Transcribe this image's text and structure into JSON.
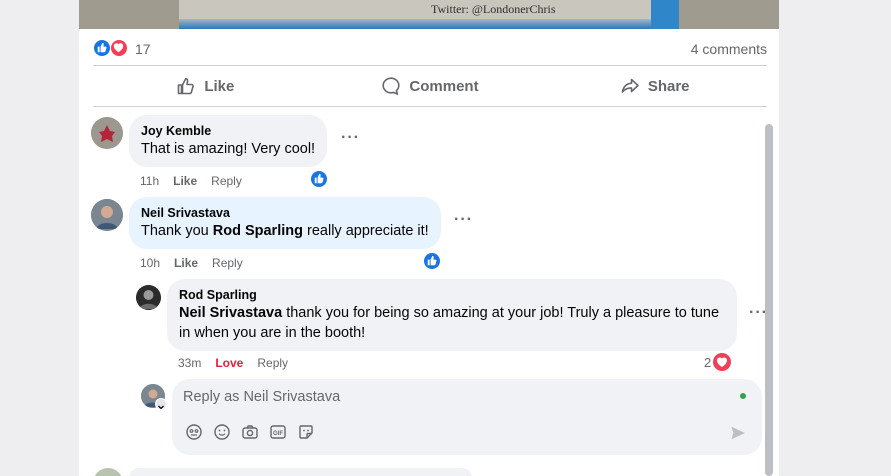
{
  "post": {
    "image_credit": "Twitter: @LondonerChris",
    "reaction_count": "17",
    "comments_count": "4 comments"
  },
  "actions": {
    "like": "Like",
    "comment": "Comment",
    "share": "Share"
  },
  "comments": [
    {
      "author": "Joy Kemble",
      "text": "That is amazing! Very cool!",
      "time": "11h",
      "like_label": "Like",
      "reply_label": "Reply"
    },
    {
      "author": "Neil Srivastava",
      "text_prefix": "Thank you ",
      "mention": "Rod Sparling",
      "text_suffix": " really appreciate it!",
      "time": "10h",
      "like_label": "Like",
      "reply_label": "Reply"
    }
  ],
  "reply": {
    "author": "Rod Sparling",
    "mention": "Neil Srivastava",
    "text_suffix": " thank you for being so amazing at your job! Truly a pleasure to tune in when you are in the booth!",
    "time": "33m",
    "reaction_label": "Love",
    "reply_label": "Reply",
    "reaction_count": "2"
  },
  "reply_box": {
    "placeholder": "Reply as Neil Srivastava"
  },
  "colors": {
    "accent": "#1b74e4",
    "love": "#f33e58",
    "bubble": "#f0f2f5",
    "online": "#31a24c"
  }
}
